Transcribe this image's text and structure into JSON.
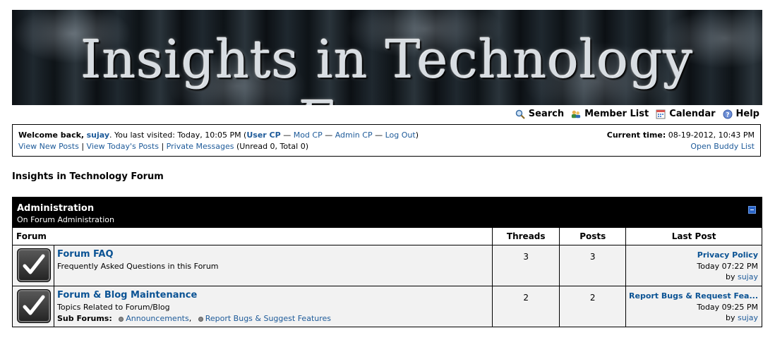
{
  "banner": {
    "title": "Insights in Technology Forum"
  },
  "topnav": [
    {
      "label": "Search",
      "icon": "search-icon"
    },
    {
      "label": "Member List",
      "icon": "members-icon"
    },
    {
      "label": "Calendar",
      "icon": "calendar-icon"
    },
    {
      "label": "Help",
      "icon": "help-icon"
    }
  ],
  "welcome": {
    "greeting": "Welcome back,",
    "username": "sujay",
    "last_visit": ". You last visited: Today, 10:05 PM (",
    "user_cp": "User CP",
    "sep": " — ",
    "mod_cp": "Mod CP",
    "admin_cp": "Admin CP",
    "log_out": "Log Out",
    "close_paren": ")",
    "view_new": "View New Posts",
    "pipe": " | ",
    "view_today": "View Today's Posts",
    "pm": "Private Messages",
    "pm_counts": " (Unread 0, Total 0)",
    "current_time_label": "Current time:",
    "current_time": "08-19-2012, 10:43 PM",
    "buddy_list": "Open Buddy List"
  },
  "page_title": "Insights in Technology Forum",
  "category": {
    "name": "Administration",
    "description": "On Forum Administration"
  },
  "columns": {
    "forum": "Forum",
    "threads": "Threads",
    "posts": "Posts",
    "last_post": "Last Post"
  },
  "forums": [
    {
      "name": "Forum FAQ",
      "description": "Frequently Asked Questions in this Forum",
      "threads": "3",
      "posts": "3",
      "last_title": "Privacy Policy",
      "last_time": "Today 07:22 PM",
      "by": "by",
      "last_user": "sujay"
    },
    {
      "name": "Forum & Blog Maintenance",
      "description": "Topics Related to Forum/Blog",
      "subforums_label": "Sub Forums:",
      "subforums": [
        "Announcements",
        "Report Bugs & Suggest Features"
      ],
      "threads": "2",
      "posts": "2",
      "last_title": "Report Bugs & Request Fea...",
      "last_time": "Today 09:25 PM",
      "by": "by",
      "last_user": "sujay"
    }
  ],
  "colors": {
    "link": "#0b5394",
    "header_bg": "#000000",
    "row_bg": "#f2f2f2"
  }
}
